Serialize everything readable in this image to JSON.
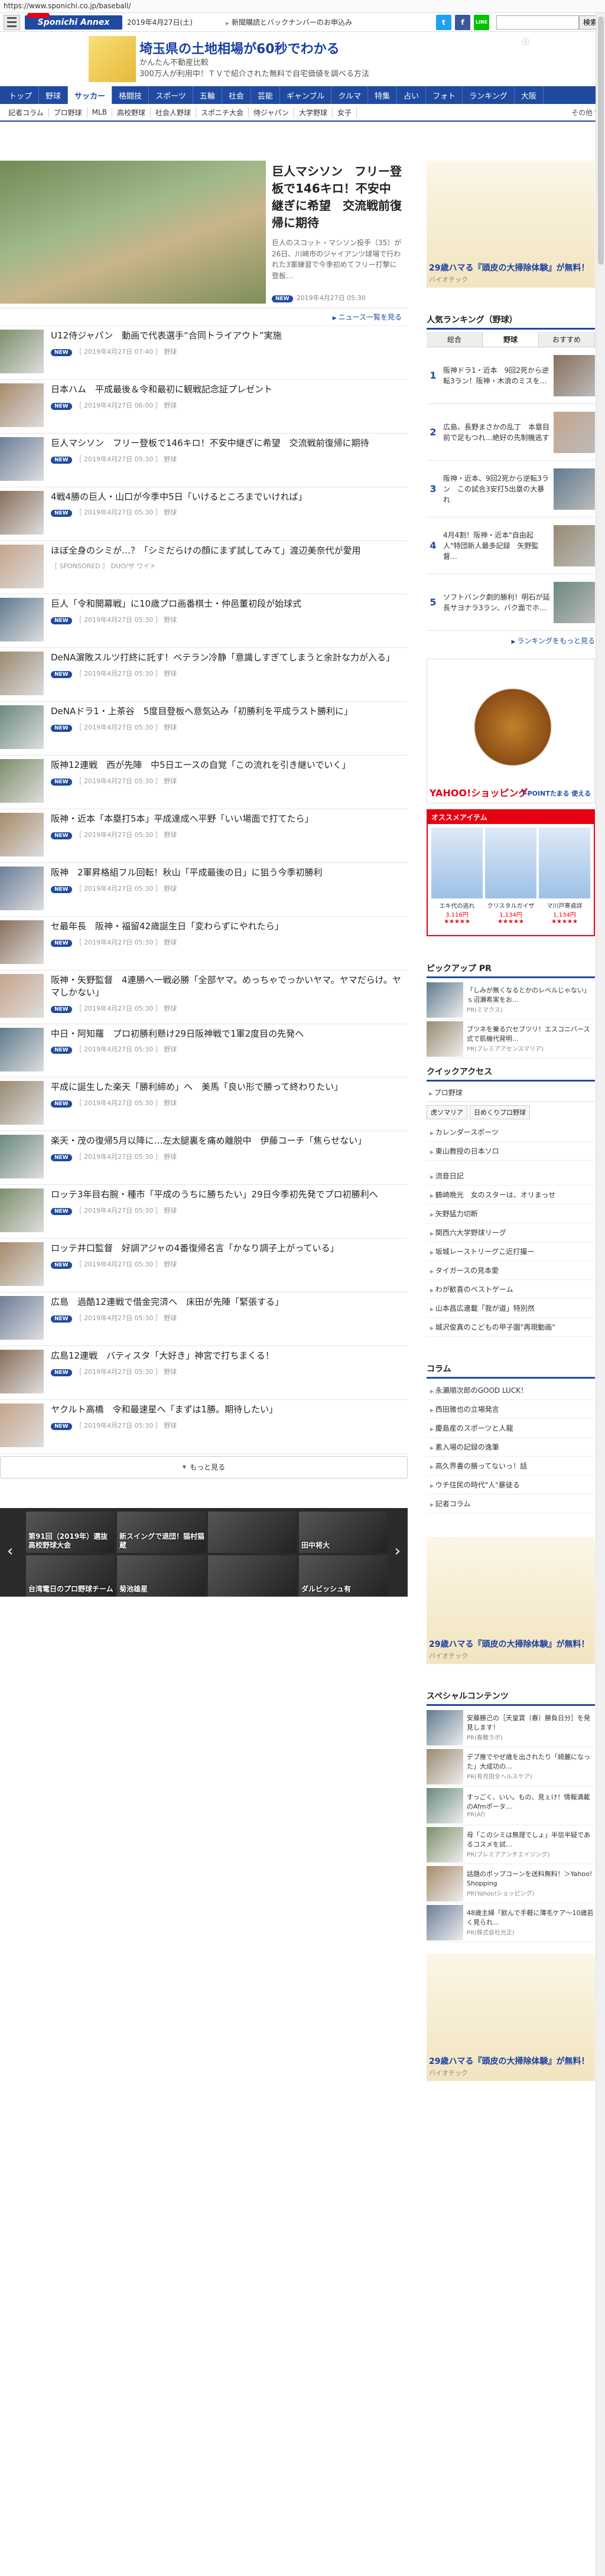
{
  "browser": {
    "url": "https://www.sponichi.co.jp/baseball/"
  },
  "header": {
    "logo": "Sponichi Annex",
    "date": "2019年4月27日(土)",
    "link": "新聞購読とバックナンバーのお申込み",
    "social": [
      "t",
      "f",
      "LINE"
    ],
    "search_placeholder": "",
    "search_button": "検索"
  },
  "top_ad": {
    "title": "埼玉県の土地相場が60秒でわかる",
    "sub1": "かんたん不動産比較",
    "sub2": "300万人が利用中！ＴＶで紹介された無料で自宅価値を調べる方法",
    "close": "ⓘ"
  },
  "gnav": [
    "トップ",
    "野球",
    "サッカー",
    "格闘技",
    "スポーツ",
    "五輪",
    "社会",
    "芸能",
    "ギャンブル",
    "クルマ",
    "特集",
    "占い",
    "フォト",
    "ランキング",
    "大阪"
  ],
  "gnav_active": 2,
  "snav": {
    "items": [
      "記者コラム",
      "プロ野球",
      "MLB",
      "高校野球",
      "社会人野球",
      "スポニチ大会",
      "侍ジャパン",
      "大学野球",
      "女子"
    ],
    "more": "その他 ▼"
  },
  "top_story": {
    "title": "巨人マシソン　フリー登板で146キロ！不安中継ぎに希望　交流戦前復帰に期待",
    "lead": "巨人のスコット・マシソン投手（35）が26日、川崎市のジャイアンツ球場で行われた3軍練習で今季初めてフリー打撃に登板…",
    "badge": "NEW",
    "time": "2019年4月27日 05:30"
  },
  "news_more": "ニュース一覧を見る",
  "articles": [
    {
      "title": "U12侍ジャパン　動画で代表選手“合同トライアウト”実施",
      "badge": "NEW",
      "meta": "［ 2019年4月27日 07:40 ］ 野球"
    },
    {
      "title": "日本ハム　平成最後＆令和最初に観戦記念証プレゼント",
      "badge": "NEW",
      "meta": "［ 2019年4月27日 06:00 ］ 野球"
    },
    {
      "title": "巨人マシソン　フリー登板で146キロ！不安中継ぎに希望　交流戦前復帰に期待",
      "badge": "NEW",
      "meta": "［ 2019年4月27日 05:30 ］ 野球"
    },
    {
      "title": "4戦4勝の巨人・山口が今季中5日「いけるところまでいければ」",
      "badge": "NEW",
      "meta": "［ 2019年4月27日 05:30 ］ 野球"
    },
    {
      "title": "ほぼ全身のシミが…？「シミだらけの顔にまず試してみて」渡辺美奈代が愛用",
      "badge": "",
      "meta": "［ SPONSORED ］ DUO/ザ ワイト"
    },
    {
      "title": "巨人「令和開幕戦」に10歳プロ画番棋士・仲邑董初段が始球式",
      "badge": "NEW",
      "meta": "［ 2019年4月27日 05:30 ］ 野球"
    },
    {
      "title": "DeNA濵敗スルツ打終に託す！ベテラン冷静「意識しすぎてしまうと余計な力が入る」",
      "badge": "NEW",
      "meta": "［ 2019年4月27日 05:30 ］ 野球"
    },
    {
      "title": "DeNAドラ1・上茶谷　5度目登板へ意気込み「初勝利を平成ラスト勝利に」",
      "badge": "NEW",
      "meta": "［ 2019年4月27日 05:30 ］ 野球"
    },
    {
      "title": "阪神12連戦　西が先陣　中5日エースの自覚「この流れを引き継いでいく」",
      "badge": "NEW",
      "meta": "［ 2019年4月27日 05:30 ］ 野球"
    },
    {
      "title": "阪神・近本「本塁打5本」平成達成へ平野「いい場面で打てたら」",
      "badge": "NEW",
      "meta": "［ 2019年4月27日 05:30 ］ 野球"
    },
    {
      "title": "阪神　2軍昇格組フル回転！秋山「平成最後の日」に狙う今季初勝利",
      "badge": "NEW",
      "meta": "［ 2019年4月27日 05:30 ］ 野球"
    },
    {
      "title": "セ最年長　阪神・福留42歳誕生日「変わらずにやれたら」",
      "badge": "NEW",
      "meta": "［ 2019年4月27日 05:30 ］ 野球"
    },
    {
      "title": "阪神・矢野監督　4連勝へ一戦必勝「全部ヤマ。めっちゃでっかいヤマ。ヤマだらけ。ヤマしかない」",
      "badge": "NEW",
      "meta": "［ 2019年4月27日 05:30 ］ 野球"
    },
    {
      "title": "中日・阿知羅　プロ初勝利懸け29日阪神戦で1軍2度目の先発へ",
      "badge": "NEW",
      "meta": "［ 2019年4月27日 05:30 ］ 野球"
    },
    {
      "title": "平成に誕生した楽天「勝利締め」へ　美馬「良い形で勝って終わりたい」",
      "badge": "NEW",
      "meta": "［ 2019年4月27日 05:30 ］ 野球"
    },
    {
      "title": "楽天・茂の復帰5月以降に…左太腿裏を痛め離脱中　伊藤コーチ「焦らせない」",
      "badge": "NEW",
      "meta": "［ 2019年4月27日 05:30 ］ 野球"
    },
    {
      "title": "ロッテ3年目右腕・種市「平成のうちに勝ちたい」29日今季初先発でプロ初勝利へ",
      "badge": "NEW",
      "meta": "［ 2019年4月27日 05:30 ］ 野球"
    },
    {
      "title": "ロッテ井口監督　好調アジャの4番復帰名言「かなり調子上がっている」",
      "badge": "NEW",
      "meta": "［ 2019年4月27日 05:30 ］ 野球"
    },
    {
      "title": "広島　過酷12連戦で借金完済へ　床田が先陣「緊張する」",
      "badge": "NEW",
      "meta": "［ 2019年4月27日 05:30 ］ 野球"
    },
    {
      "title": "広島12連戦　バティスタ「大好き」神宮で打ちまくる！",
      "badge": "NEW",
      "meta": "［ 2019年4月27日 05:30 ］ 野球"
    },
    {
      "title": "ヤクルト高橋　令和最速星へ「まずは1勝。期待したい」",
      "badge": "NEW",
      "meta": "［ 2019年4月27日 05:30 ］ 野球"
    }
  ],
  "load_more": "もっと見る",
  "carousel": [
    "第91回（2019年）選抜高校野球大会",
    "新スイングで退団！猫村猫蔵",
    "",
    "田中将大",
    "台湾電日のプロ野球チーム",
    "菊池雄星",
    "",
    "ダルビッシュ有"
  ],
  "side": {
    "ad_title": "29歳ハマる『頭皮の大掃除体験』が無料！",
    "ad_sponsor": "バイオテック",
    "ranking_title": "人気ランキング（野球）",
    "ranking_tabs": [
      "総合",
      "野球",
      "おすすめ"
    ],
    "ranking": [
      {
        "n": "1",
        "t": "阪神ドラ1・近本　9回2死から逆転3ラン！阪神・木浪のミスを…"
      },
      {
        "n": "2",
        "t": "広島、長野まさかの乱丁　本塁目前で足もつれ…絶好の先制機逃す"
      },
      {
        "n": "3",
        "t": "阪神・近本、9回2死から逆転3ラン　この試合3安打5出塁の大暴れ"
      },
      {
        "n": "4",
        "t": "4月4割！阪神・近本\"自由起人\"特団新人最多記録　矢野監督…"
      },
      {
        "n": "5",
        "t": "ソフトバンク劇的勝利！明石が延長サヨナラ3ラン、バク面でホ…"
      }
    ],
    "ranking_more": "ランキングをもっと見る",
    "yahoo_label": "YAHOO!ショッピング",
    "yahoo_point": "T-POINTたまる 使える",
    "osusume_title": "オススメアイテム",
    "osusume": [
      {
        "name": "エキ代の逃れ",
        "price": "3,116円",
        "stars": "★★★★★"
      },
      {
        "name": "クリスタルガイザ",
        "price": "1,134円",
        "stars": "★★★★★"
      },
      {
        "name": "マ川戸寒貞詳",
        "price": "1,134円",
        "stars": "★★★★★"
      }
    ],
    "pickup_title": "ピックアップ PR",
    "pickup": [
      {
        "t": "「しみが無くなるとかのレベルじゃない」ｓ沼瀬希実をお...",
        "s": "PR(ミマクス)"
      },
      {
        "t": "ブツネを乗る穴セブツリ！エスコニバース式で肌機代発明...",
        "s": "PR(プレミアアセンスマリア)"
      }
    ],
    "quick_title": "クイックアクセス",
    "quick_head": "プロ野球",
    "quick_chips": [
      "虎ソマリア",
      "日めくりプロ野球"
    ],
    "quick_links": [
      "カレンダースポーツ",
      "東山教授の日本ソロ"
    ],
    "links": [
      "流音日記",
      "鶴崎晩光　女のスターは、オリまっせ",
      "矢野猛力切断",
      "関西六大学野球リーグ",
      "坂城レーストリーグこ近打撮ー",
      "タイガースの見本愛",
      "わが歓喜のベストゲーム",
      "山本昌広連載「我が道」特別然",
      "城沢俊真のこどもの甲子園\"再現動画\""
    ],
    "column_title": "コラム",
    "columns": [
      "永瀬順次郎のGOOD LUCK！",
      "西田雅也の立場発言",
      "慶島産のスポーツと人龍",
      "素入場の記録の逸筆",
      "高久界書の勝ってないっ！話",
      "ウチ住民の時代\"人\"暴徒る",
      "記者コラム"
    ],
    "special_title": "スペシャルコンテンツ",
    "special": [
      {
        "t": "安藤勝己の［天皇賞（春）勝負日分］を発見します！",
        "s": "PR(春難ラボ)"
      },
      {
        "t": "デブ推でやぜ歳を出されたり「綺麗になった」大成功の…",
        "s": "PR(有月田全ヘルスケア)"
      },
      {
        "t": "すっごく、いい。もの、見ぇけ！情報満載のAfmポータ…",
        "s": "PR(Af)"
      },
      {
        "t": "母「このシミは無理でしょ」半信半疑であるコスメを試…",
        "s": "PR(プレミアアンチエイジング)"
      },
      {
        "t": "話題のポップコーンを送料無料！＞Yahoo! Shopping",
        "s": "PR(Yahoo!ショッピング)"
      },
      {
        "t": "48歳主婦「飲んで手軽に薄毛ケア～10歳若く見られ…",
        "s": "PR(株式会社光正)"
      }
    ]
  },
  "colors": {
    "brand": "#1f4aa0",
    "accent": "#e60012"
  }
}
